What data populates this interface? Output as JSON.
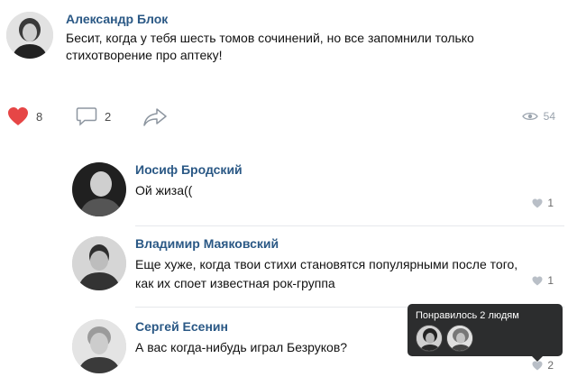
{
  "post": {
    "author": "Александр Блок",
    "text": "Бесит, когда у тебя шесть томов сочинений, но все запомнили только стихотворение про аптеку!",
    "likes": "8",
    "comments": "2",
    "views": "54"
  },
  "comments": [
    {
      "author": "Иосиф Бродский",
      "text": "Ой жиза((",
      "likes": "1"
    },
    {
      "author": "Владимир Маяковский",
      "text": "Еще хуже, когда твои стихи становятся популярными после того, как их споет известная рок-группа",
      "likes": "1"
    },
    {
      "author": "Сергей Есенин",
      "text": "А вас когда-нибудь играл Безруков?",
      "likes": "2"
    }
  ],
  "tooltip": {
    "title": "Понравилось 2 людям"
  },
  "colors": {
    "like_red": "#e64646",
    "name_blue": "#2a5885",
    "muted": "#9aa3ad",
    "tooltip_bg": "#2c2d2e"
  },
  "icons": [
    "heart-icon",
    "comment-icon",
    "share-icon",
    "eye-icon"
  ]
}
